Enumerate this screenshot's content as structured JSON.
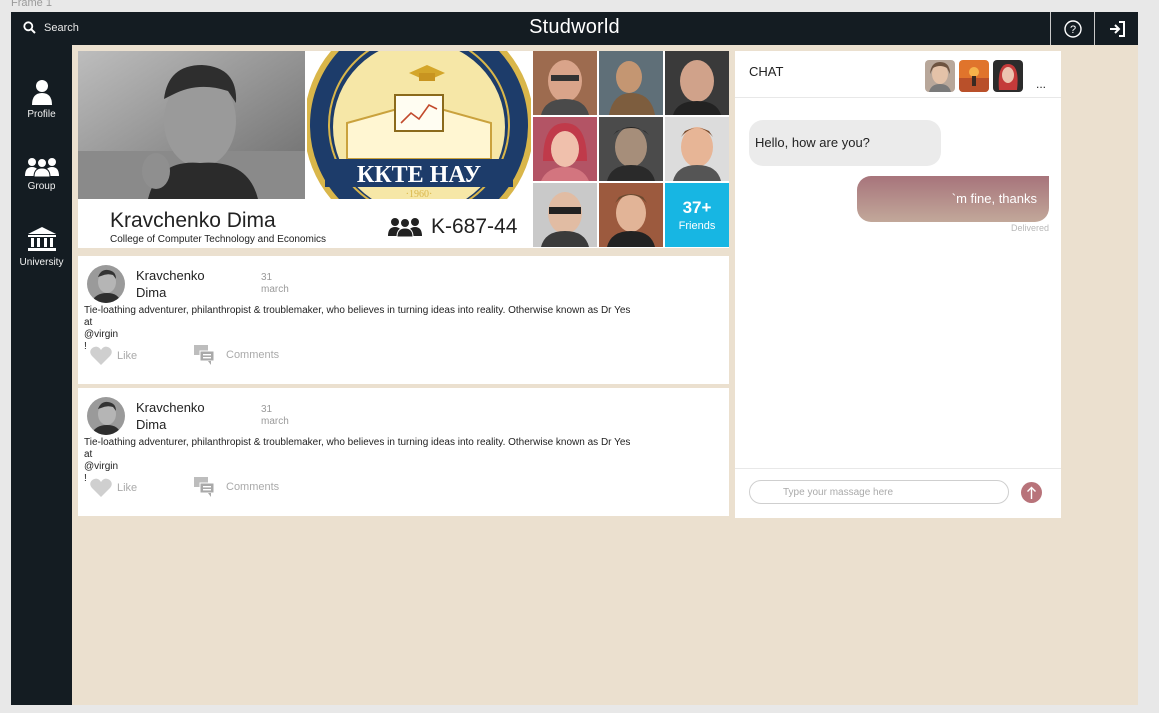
{
  "frame": {
    "label": "Frame 1"
  },
  "topbar": {
    "search_label": "Search",
    "title": "Studworld",
    "help_icon": "help-icon",
    "logout_icon": "logout-icon"
  },
  "sidebar": {
    "items": [
      {
        "label": "Profile",
        "icon": "user-icon"
      },
      {
        "label": "Group",
        "icon": "group-icon"
      },
      {
        "label": "University",
        "icon": "university-icon"
      }
    ]
  },
  "profile": {
    "name": "Kravchenko Dima",
    "college": "College of Computer Technology and Economics",
    "group_code": "K-687-44",
    "logo": {
      "main_text": "ККТЕ НАУ",
      "year": "·1960·"
    },
    "friends_count": "37+",
    "friends_label": "Friends"
  },
  "posts": [
    {
      "author_first": "Kravchenko",
      "author_last": "Dima",
      "date_day": "31",
      "date_month": "march",
      "text_line1": "Tie-loathing adventurer, philanthropist & troublemaker, who believes in turning ideas into reality. Otherwise known as Dr Yes",
      "text_line2": "at",
      "text_line3": "@virgin",
      "text_line4": "!",
      "like_label": "Like",
      "comments_label": "Comments"
    },
    {
      "author_first": "Kravchenko",
      "author_last": "Dima",
      "date_day": "31",
      "date_month": "march",
      "text_line1": "Tie-loathing adventurer, philanthropist & troublemaker, who believes in turning ideas into reality. Otherwise known as Dr Yes",
      "text_line2": "at",
      "text_line3": "@virgin",
      "text_line4": "!",
      "like_label": "Like",
      "comments_label": "Comments"
    }
  ],
  "chat": {
    "title": "CHAT",
    "more": "...",
    "messages": [
      {
        "direction": "in",
        "text": "Hello, how are you?"
      },
      {
        "direction": "out",
        "text": "`m fine, thanks",
        "status": "Delivered"
      }
    ],
    "input_placeholder": "Type your massage here"
  },
  "colors": {
    "dark": "#141c22",
    "background": "#ebe0cf",
    "accent_blue": "#17b6e3",
    "send_button": "#b8737a",
    "outgoing_bubble": "#a7747b"
  }
}
